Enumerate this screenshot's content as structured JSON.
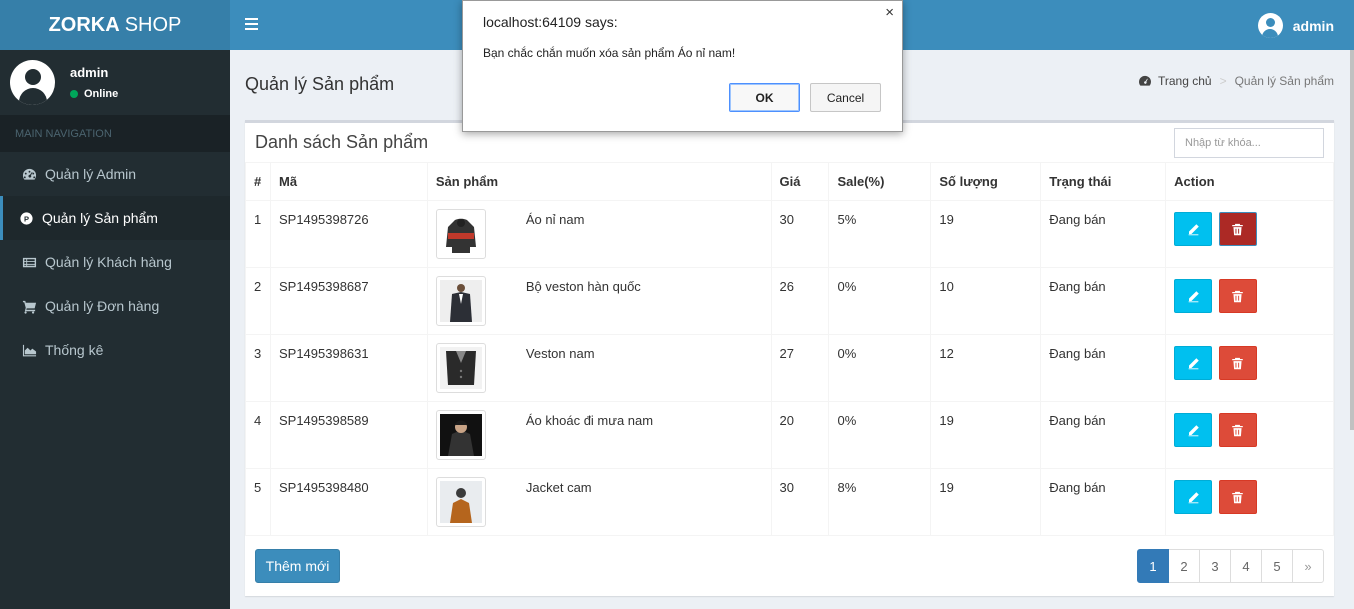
{
  "brand": {
    "bold": "ZORKA",
    "rest": "SHOP"
  },
  "sidebar": {
    "user_name": "admin",
    "user_status": "Online",
    "nav_header": "MAIN NAVIGATION",
    "items": [
      {
        "label": "Quản lý Admin",
        "icon": "dashboard-icon"
      },
      {
        "label": "Quản lý Sản phẩm",
        "icon": "product-icon"
      },
      {
        "label": "Quản lý Khách hàng",
        "icon": "customer-list-icon"
      },
      {
        "label": "Quản lý Đơn hàng",
        "icon": "cart-icon"
      },
      {
        "label": "Thống kê",
        "icon": "area-chart-icon"
      }
    ]
  },
  "topbar": {
    "user_name": "admin"
  },
  "header": {
    "title": "Quản lý Sản phẩm",
    "breadcrumb_home": "Trang chủ",
    "breadcrumb_sep": ">",
    "breadcrumb_current": "Quản lý Sản phẩm"
  },
  "box": {
    "title": "Danh sách Sản phẩm",
    "search_placeholder": "Nhập từ khóa..."
  },
  "table": {
    "headers": [
      "#",
      "Mã",
      "Sản phẩm",
      "Giá",
      "Sale(%)",
      "Số lượng",
      "Trạng thái",
      "Action"
    ],
    "rows": [
      {
        "idx": "1",
        "code": "SP1495398726",
        "name": "Áo nỉ nam",
        "price": "30",
        "sale": "5%",
        "qty": "19",
        "status": "Đang bán"
      },
      {
        "idx": "2",
        "code": "SP1495398687",
        "name": "Bộ veston hàn quốc",
        "price": "26",
        "sale": "0%",
        "qty": "10",
        "status": "Đang bán"
      },
      {
        "idx": "3",
        "code": "SP1495398631",
        "name": "Veston nam",
        "price": "27",
        "sale": "0%",
        "qty": "12",
        "status": "Đang bán"
      },
      {
        "idx": "4",
        "code": "SP1495398589",
        "name": "Áo khoác đi mưa nam",
        "price": "20",
        "sale": "0%",
        "qty": "19",
        "status": "Đang bán"
      },
      {
        "idx": "5",
        "code": "SP1495398480",
        "name": "Jacket cam",
        "price": "30",
        "sale": "8%",
        "qty": "19",
        "status": "Đang bán"
      }
    ]
  },
  "footer": {
    "add_label": "Thêm mới",
    "pages": [
      "1",
      "2",
      "3",
      "4",
      "5",
      "»"
    ]
  },
  "dialog": {
    "title": "localhost:64109 says:",
    "close": "×",
    "message": "Bạn chắc chắn muốn xóa sản phẩm Áo nỉ nam!",
    "ok": "OK",
    "cancel": "Cancel"
  }
}
